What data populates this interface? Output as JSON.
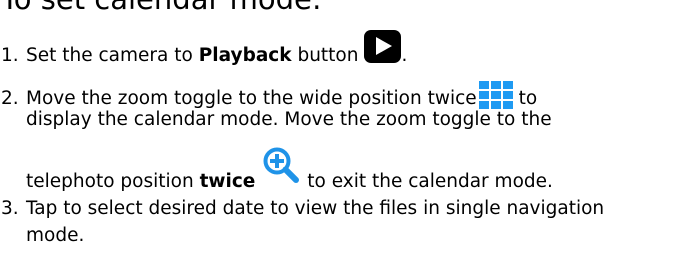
{
  "heading": "To set calendar mode:",
  "steps": [
    {
      "number": "1.",
      "text_before": "Set the camera to ",
      "bold": "Playback",
      "text_after": " button",
      "end": "."
    },
    {
      "number": "2.",
      "line1_text": "Move the zoom toggle to the wide position twice",
      "line1_after": "to",
      "line2_text": "display the calendar mode.  Move the zoom toggle to the",
      "line3_text": "telephoto position ",
      "line3_bold": "twice",
      "line3_after": "to exit the calendar mode."
    },
    {
      "number": "3.",
      "line1_text": "Tap to select desired date to view the files in single navigation",
      "line2_text": "mode."
    }
  ],
  "icons": {
    "playback": "playback-icon",
    "calendar_grid": "calendar-grid-icon",
    "zoom_in": "zoom-in-magnifier-icon"
  },
  "colors": {
    "text": "#000000",
    "grid_blue": "#1e9af2",
    "zoom_blue": "#1f93e8"
  }
}
